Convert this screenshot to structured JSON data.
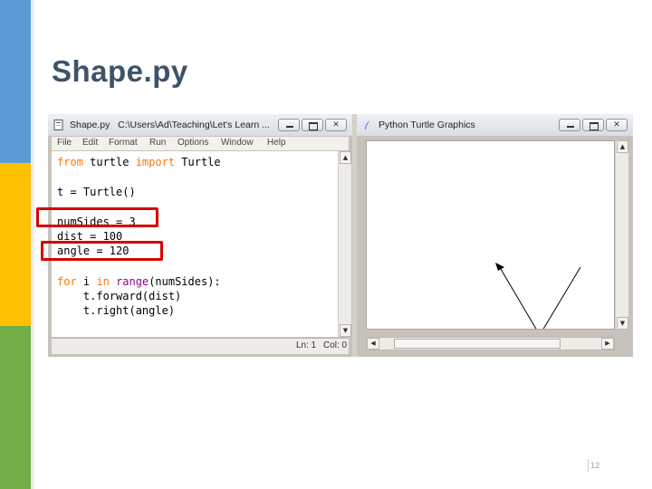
{
  "slide": {
    "title": "Shape.py",
    "page_number": "12",
    "colors": {
      "stripe_top": "#5b9bd5",
      "stripe_middle": "#ffc000",
      "stripe_bottom": "#70ad47",
      "title": "#3e5368",
      "highlight": "#d60000"
    }
  },
  "editor": {
    "title": "Shape.py   C:\\Users\\Ad\\Teaching\\Let's Learn ...",
    "icon": "python-file-icon",
    "menu": [
      "File",
      "Edit",
      "Format",
      "Run",
      "Options",
      "Window",
      "Help"
    ],
    "code": {
      "line1": {
        "kw1": "from",
        "mod": " turtle ",
        "kw2": "import",
        "name": " Turtle"
      },
      "line2": "t = Turtle()",
      "line3": "numSides = 3",
      "line4": "dist = 100",
      "line5": "angle = 120",
      "line6": {
        "kw1": "for",
        "var": " i ",
        "kw2": "in",
        "sp": " ",
        "bi": "range",
        "rest": "(numSides):"
      },
      "line7": "    t.forward(dist)",
      "line8": "    t.right(angle)"
    },
    "status": {
      "line": "Ln: 1",
      "col": "Col: 0"
    }
  },
  "turtle_window": {
    "title": "Python Turtle Graphics",
    "icon": "feather-icon"
  },
  "window_buttons": {
    "minimize_icon": "minimize-icon",
    "maximize_icon": "maximize-icon",
    "close_label": "✕"
  }
}
